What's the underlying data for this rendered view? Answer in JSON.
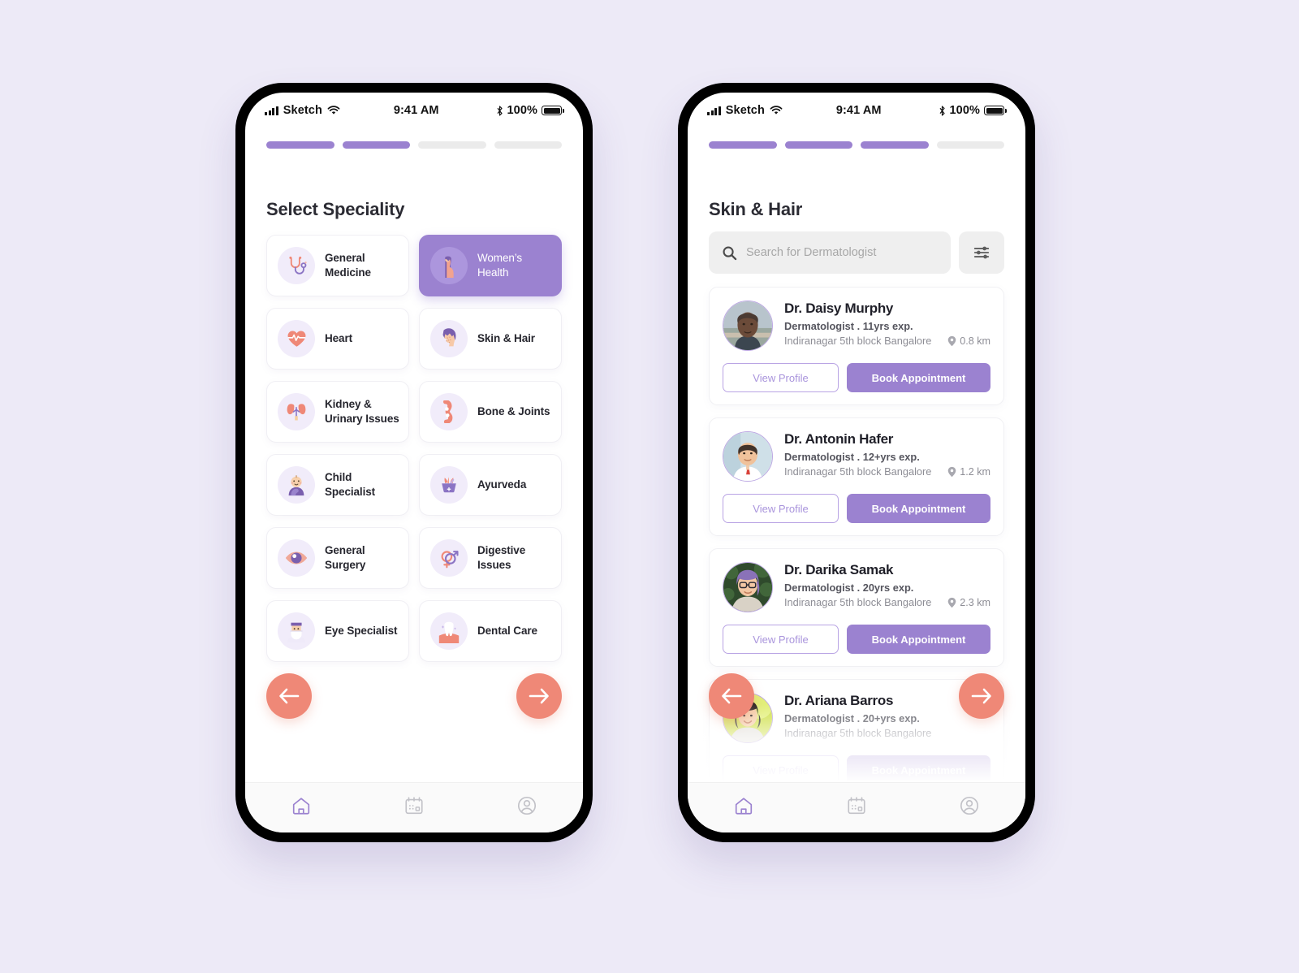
{
  "background_color": "#edeaf7",
  "accent_purple": "#9b82d0",
  "accent_coral": "#ef8877",
  "statusbar": {
    "carrier": "Sketch",
    "time": "9:41 AM",
    "battery": "100%",
    "wifi_icon": "wifi-icon",
    "signal_icon": "signal-bars-icon",
    "bluetooth_icon": "bluetooth-icon",
    "battery_icon": "battery-full-icon"
  },
  "screen_left": {
    "progress": {
      "total": 4,
      "filled": 2
    },
    "title": "Select Speciality",
    "specialities": [
      {
        "label": "General Medicine",
        "icon": "stethoscope-icon",
        "selected": false
      },
      {
        "label": "Women’s Health",
        "icon": "pregnant-woman-icon",
        "selected": true
      },
      {
        "label": "Heart",
        "icon": "heart-pulse-icon",
        "selected": false
      },
      {
        "label": "Skin & Hair",
        "icon": "face-skin-icon",
        "selected": false
      },
      {
        "label": "Kidney & Urinary Issues",
        "icon": "kidneys-icon",
        "selected": false
      },
      {
        "label": "Bone & Joints",
        "icon": "knee-joint-icon",
        "selected": false
      },
      {
        "label": "Child Specialist",
        "icon": "baby-icon",
        "selected": false
      },
      {
        "label": "Ayurveda",
        "icon": "mortar-pestle-herbs-icon",
        "selected": false
      },
      {
        "label": "General Surgery",
        "icon": "eye-icon",
        "selected": false
      },
      {
        "label": "Digestive Issues",
        "icon": "gender-symbols-icon",
        "selected": false
      },
      {
        "label": "Eye Specialist",
        "icon": "surgeon-mask-icon",
        "selected": false
      },
      {
        "label": "Dental Care",
        "icon": "tooth-icon",
        "selected": false
      }
    ],
    "prev_label": "arrow-left-icon",
    "next_label": "arrow-right-icon"
  },
  "screen_right": {
    "progress": {
      "total": 4,
      "filled": 3
    },
    "title": "Skin & Hair",
    "search": {
      "placeholder": "Search for Dermatologist",
      "value": "",
      "icon": "search-icon"
    },
    "filter_icon": "filter-sliders-icon",
    "doctors": [
      {
        "name": "Dr. Daisy Murphy",
        "speciality": "Dermatologist . 11yrs exp.",
        "address": "Indiranagar 5th block Bangalore",
        "distance": "0.8 km",
        "view_profile": "View Profile",
        "book": "Book Appointment",
        "avatar": "elderly-man-photo"
      },
      {
        "name": "Dr. Antonin Hafer",
        "speciality": "Dermatologist . 12+yrs exp.",
        "address": "Indiranagar 5th block Bangalore",
        "distance": "1.2 km",
        "view_profile": "View Profile",
        "book": "Book Appointment",
        "avatar": "young-man-photo"
      },
      {
        "name": "Dr. Darika Samak",
        "speciality": "Dermatologist . 20yrs exp.",
        "address": "Indiranagar 5th block Bangalore",
        "distance": "2.3 km",
        "view_profile": "View Profile",
        "book": "Book Appointment",
        "avatar": "woman-glasses-photo"
      },
      {
        "name": "Dr. Ariana Barros",
        "speciality": "Dermatologist . 20+yrs exp.",
        "address": "Indiranagar 5th block Bangalore",
        "distance": "",
        "view_profile": "View Profile",
        "book": "Book Appointment",
        "avatar": "woman-smiling-photo"
      }
    ],
    "prev_label": "arrow-left-icon",
    "next_label": "arrow-right-icon"
  },
  "tabbar": {
    "items": [
      {
        "name": "home",
        "icon": "home-icon",
        "active": true
      },
      {
        "name": "appointments",
        "icon": "calendar-icon",
        "active": false
      },
      {
        "name": "profile",
        "icon": "user-circle-icon",
        "active": false
      }
    ]
  }
}
